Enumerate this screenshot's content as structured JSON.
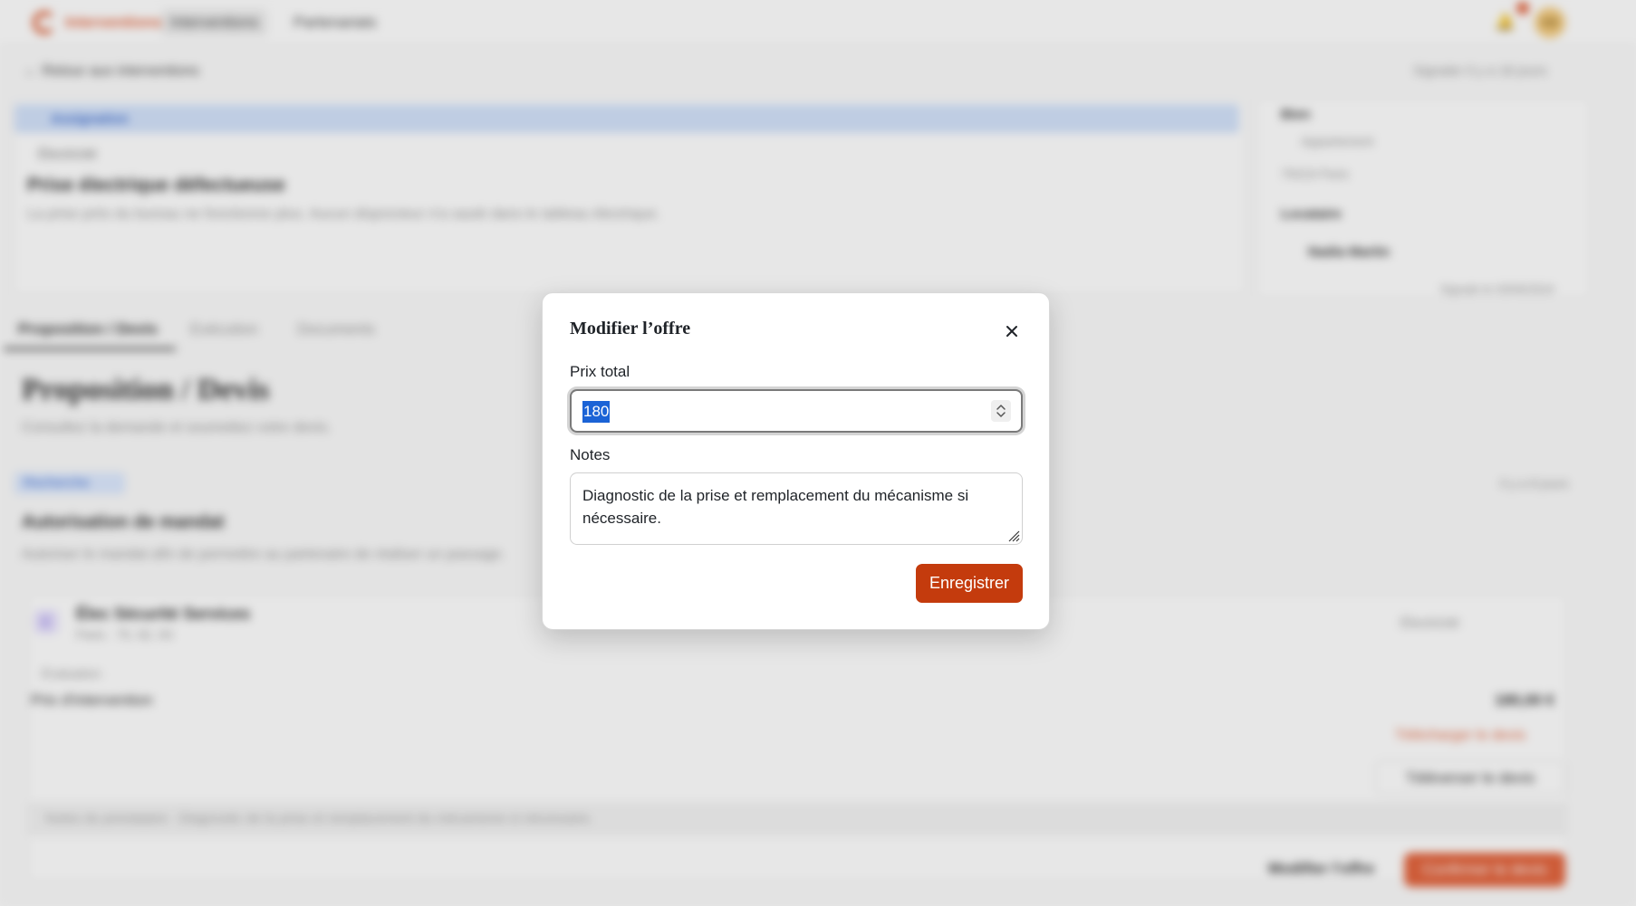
{
  "app": {
    "brand": "Interventions",
    "nav": [
      {
        "label": "Interventions",
        "active": true
      },
      {
        "label": "Partenariats",
        "active": false
      }
    ],
    "user_initials": "KB"
  },
  "page": {
    "back_label": "Retour aux interventions",
    "signal_label": "Signaler il y a 18 jours",
    "category_label": "Assignation",
    "trade_chip": "Électricité",
    "title": "Prise électrique défectueuse",
    "description": "La prise près du bureau ne fonctionne plus. Aucun disjoncteur n'a sauté dans le tableau électrique.",
    "side": {
      "bien_label": "Bien",
      "type": "Appartement",
      "city": "75019 Paris",
      "locataire_label": "Locataire",
      "tenant_name": "Nadia Martin",
      "footnote": "Signale le 03/06/2024"
    },
    "tabs": [
      "Proposition / Devis",
      "Exécution",
      "Documents"
    ],
    "section_title": "Proposition / Devis",
    "section_sub": "Consultez la demande et soumettez votre devis.",
    "status_badge": "Recherche",
    "status_right": "Il y a 8 jours",
    "mandate_title": "Autorisation de mandat",
    "mandate_text": "Autoriser le mandat afin de permettre au partenaire de réaliser un passage.",
    "partner": {
      "initial": "E",
      "name": "Élec Sécurité Services",
      "areas": "Paris · 75, 92, 93",
      "trade": "Électricité",
      "state": "Évaluation",
      "price_label": "Prix d'intervention",
      "price_value": "180,00 €",
      "download_label": "Télécharger le devis",
      "upload_label": "Téléverser le devis",
      "notes_line": "Notes du prestataire : Diagnostic de la prise et remplacement du mécanisme si nécessaire.",
      "edit_label": "Modifier l'offre",
      "confirm_label": "Confirmer le devis"
    }
  },
  "modal": {
    "title": "Modifier l’offre",
    "price_label": "Prix total",
    "price_value": "180",
    "notes_label": "Notes",
    "notes_value": "Diagnostic de la prise et remplacement du mécanisme si nécessaire.",
    "save_label": "Enregistrer"
  },
  "colors": {
    "accent": "#c43b0d",
    "selection": "#1b63d6",
    "category_band": "#cfe0fb"
  },
  "icons": {
    "close": "close-icon",
    "stepper": "chevron-up-down-icon",
    "resize": "resize-grip-icon"
  }
}
